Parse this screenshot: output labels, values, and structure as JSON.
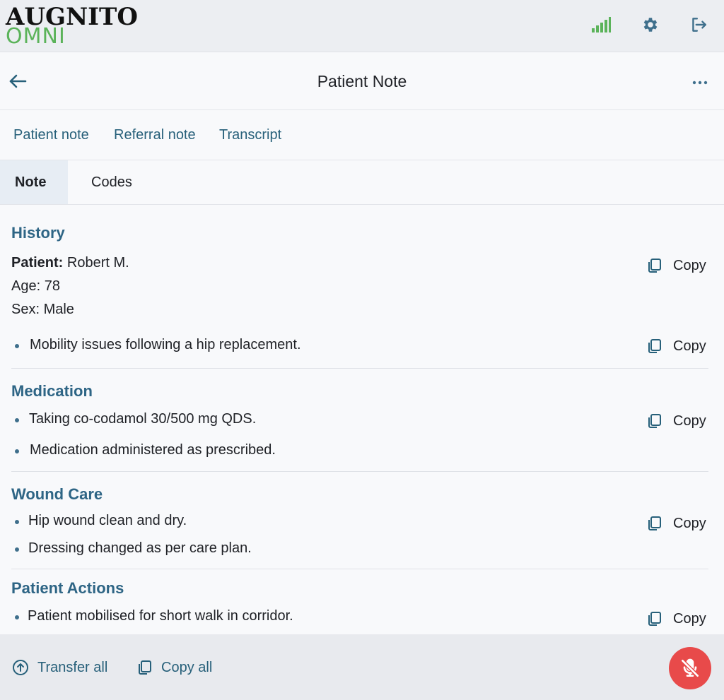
{
  "app": {
    "logo_line1": "AUGNITO",
    "logo_line2": "OMNI"
  },
  "header": {
    "title": "Patient Note"
  },
  "doc_tabs": [
    "Patient note",
    "Referral note",
    "Transcript"
  ],
  "sub_tabs": [
    "Note",
    "Codes"
  ],
  "sections": {
    "history": {
      "title": "History",
      "patient_label": "Patient:",
      "patient_value": " Robert M.",
      "age": "Age: 78",
      "sex": "Sex: Male",
      "bullet1": "Mobility issues following a hip replacement."
    },
    "medication": {
      "title": "Medication",
      "bullet1": "Taking co-codamol 30/500 mg QDS.",
      "bullet2": "Medication administered as prescribed."
    },
    "wound_care": {
      "title": "Wound Care",
      "bullet1": "Hip wound clean and dry.",
      "bullet2": "Dressing changed as per care plan."
    },
    "patient_actions": {
      "title": "Patient Actions",
      "bullet1": "Patient mobilised for short walk in corridor."
    }
  },
  "copy_label": "Copy",
  "bottom": {
    "transfer_all": "Transfer all",
    "copy_all": "Copy all"
  },
  "colors": {
    "accent": "#27607a",
    "section_title": "#2e6585",
    "logo_green": "#5bb35a",
    "mic_red": "#e84a4a"
  }
}
